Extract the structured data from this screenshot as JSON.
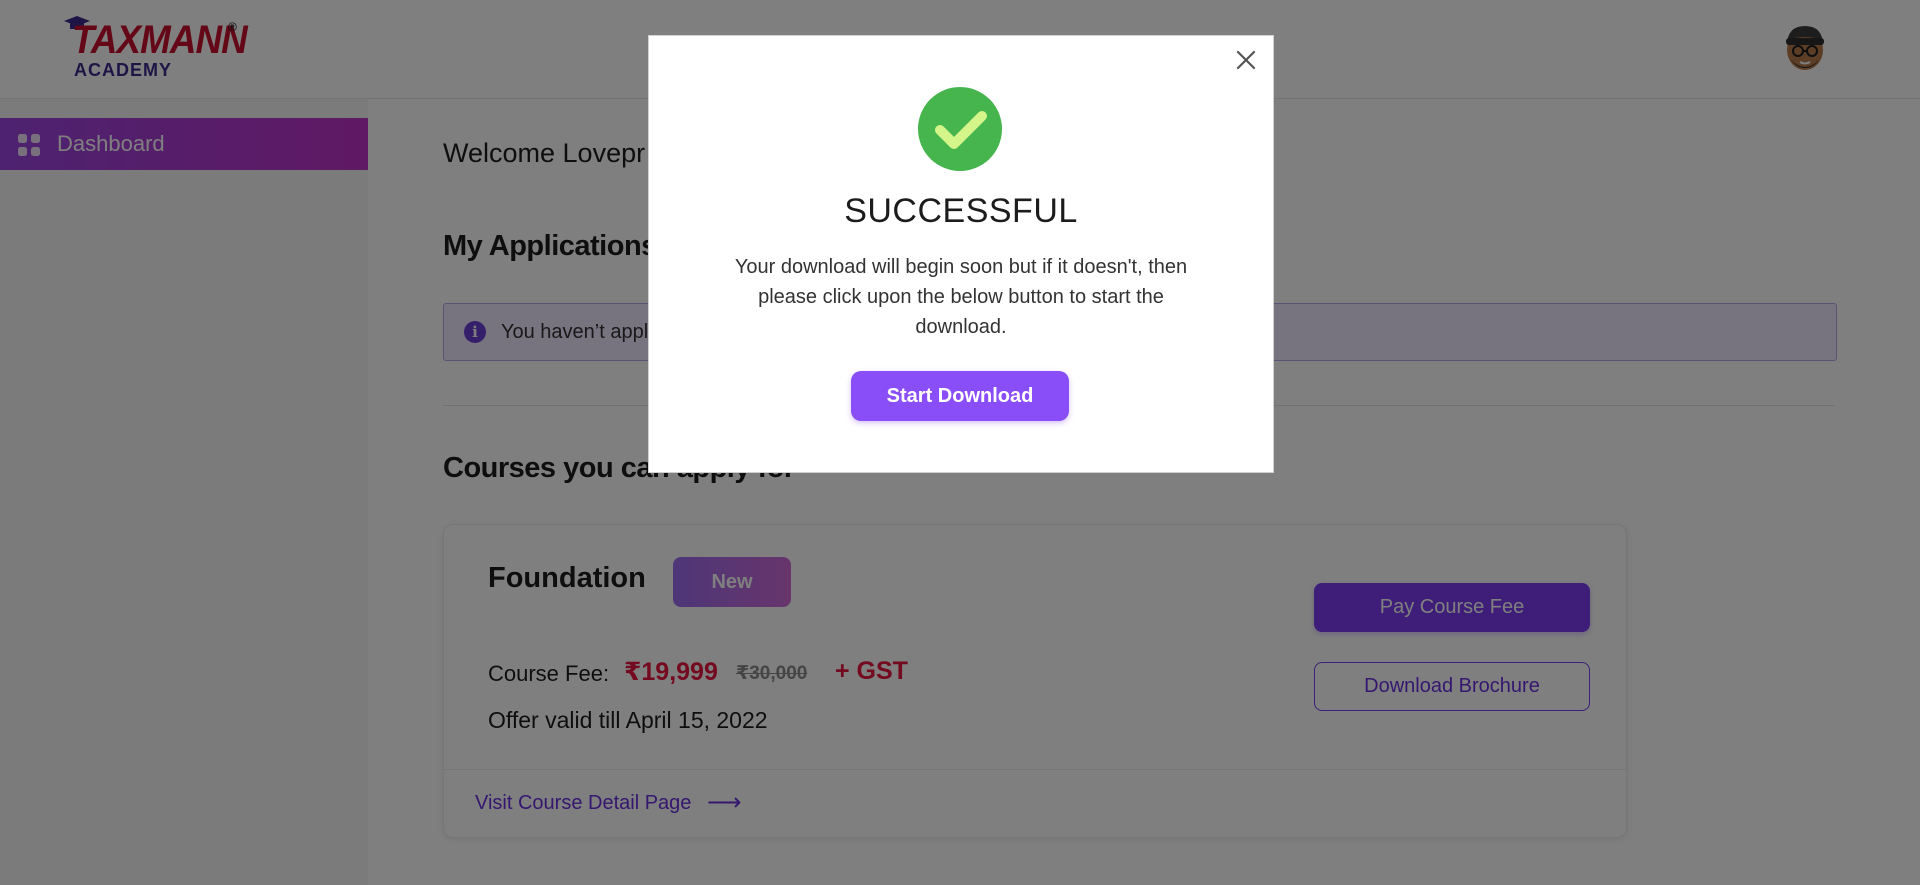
{
  "header": {
    "logo_main": "TAXMANN",
    "logo_reg": "®",
    "logo_sub": "ACADEMY"
  },
  "sidebar": {
    "items": [
      {
        "label": "Dashboard",
        "icon": "grid-icon",
        "active": true
      }
    ]
  },
  "main": {
    "welcome": "Welcome Lovepr",
    "applications_heading": "My Applications",
    "info_text": "You haven’t appli",
    "courses_heading": "Courses you can apply for"
  },
  "course_card": {
    "title": "Foundation",
    "badge": "New",
    "fee_label": "Course Fee:",
    "price": "₹19,999",
    "old_price": "₹30,000",
    "gst": "+ GST",
    "offer": "Offer valid till April 15, 2022",
    "pay_button": "Pay Course Fee",
    "brochure_button": "Download Brochure",
    "visit_link": "Visit Course Detail Page",
    "visit_arrow": "⟶"
  },
  "modal": {
    "title": "SUCCESSFUL",
    "message": "Your download will begin soon but if it doesn't, then please click upon the below button to start the download.",
    "button": "Start Download",
    "close_icon": "close-icon",
    "status_icon": "check-circle-icon"
  },
  "colors": {
    "accent": "#8a4ef8",
    "sidebar_active_start": "#9b45e0",
    "sidebar_active_end": "#c032c8",
    "price_red": "#e8153e",
    "success_green": "#46b54e",
    "check_mark": "#d4f58a"
  }
}
